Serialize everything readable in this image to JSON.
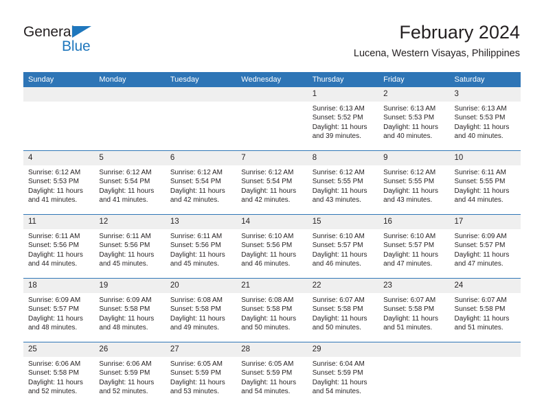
{
  "brand": {
    "name_top": "General",
    "name_bottom": "Blue",
    "accent_color": "#1f77bd"
  },
  "header": {
    "title": "February 2024",
    "subtitle": "Lucena, Western Visayas, Philippines"
  },
  "theme": {
    "header_blue": "#2e75b6",
    "daynum_gray": "#efefef",
    "text": "#231f20"
  },
  "weekday_headers": [
    "Sunday",
    "Monday",
    "Tuesday",
    "Wednesday",
    "Thursday",
    "Friday",
    "Saturday"
  ],
  "weeks": [
    [
      {
        "day": "",
        "sunrise": "",
        "sunset": "",
        "daylight_line1": "",
        "daylight_line2": ""
      },
      {
        "day": "",
        "sunrise": "",
        "sunset": "",
        "daylight_line1": "",
        "daylight_line2": ""
      },
      {
        "day": "",
        "sunrise": "",
        "sunset": "",
        "daylight_line1": "",
        "daylight_line2": ""
      },
      {
        "day": "",
        "sunrise": "",
        "sunset": "",
        "daylight_line1": "",
        "daylight_line2": ""
      },
      {
        "day": "1",
        "sunrise": "Sunrise: 6:13 AM",
        "sunset": "Sunset: 5:52 PM",
        "daylight_line1": "Daylight: 11 hours",
        "daylight_line2": "and 39 minutes."
      },
      {
        "day": "2",
        "sunrise": "Sunrise: 6:13 AM",
        "sunset": "Sunset: 5:53 PM",
        "daylight_line1": "Daylight: 11 hours",
        "daylight_line2": "and 40 minutes."
      },
      {
        "day": "3",
        "sunrise": "Sunrise: 6:13 AM",
        "sunset": "Sunset: 5:53 PM",
        "daylight_line1": "Daylight: 11 hours",
        "daylight_line2": "and 40 minutes."
      }
    ],
    [
      {
        "day": "4",
        "sunrise": "Sunrise: 6:12 AM",
        "sunset": "Sunset: 5:53 PM",
        "daylight_line1": "Daylight: 11 hours",
        "daylight_line2": "and 41 minutes."
      },
      {
        "day": "5",
        "sunrise": "Sunrise: 6:12 AM",
        "sunset": "Sunset: 5:54 PM",
        "daylight_line1": "Daylight: 11 hours",
        "daylight_line2": "and 41 minutes."
      },
      {
        "day": "6",
        "sunrise": "Sunrise: 6:12 AM",
        "sunset": "Sunset: 5:54 PM",
        "daylight_line1": "Daylight: 11 hours",
        "daylight_line2": "and 42 minutes."
      },
      {
        "day": "7",
        "sunrise": "Sunrise: 6:12 AM",
        "sunset": "Sunset: 5:54 PM",
        "daylight_line1": "Daylight: 11 hours",
        "daylight_line2": "and 42 minutes."
      },
      {
        "day": "8",
        "sunrise": "Sunrise: 6:12 AM",
        "sunset": "Sunset: 5:55 PM",
        "daylight_line1": "Daylight: 11 hours",
        "daylight_line2": "and 43 minutes."
      },
      {
        "day": "9",
        "sunrise": "Sunrise: 6:12 AM",
        "sunset": "Sunset: 5:55 PM",
        "daylight_line1": "Daylight: 11 hours",
        "daylight_line2": "and 43 minutes."
      },
      {
        "day": "10",
        "sunrise": "Sunrise: 6:11 AM",
        "sunset": "Sunset: 5:55 PM",
        "daylight_line1": "Daylight: 11 hours",
        "daylight_line2": "and 44 minutes."
      }
    ],
    [
      {
        "day": "11",
        "sunrise": "Sunrise: 6:11 AM",
        "sunset": "Sunset: 5:56 PM",
        "daylight_line1": "Daylight: 11 hours",
        "daylight_line2": "and 44 minutes."
      },
      {
        "day": "12",
        "sunrise": "Sunrise: 6:11 AM",
        "sunset": "Sunset: 5:56 PM",
        "daylight_line1": "Daylight: 11 hours",
        "daylight_line2": "and 45 minutes."
      },
      {
        "day": "13",
        "sunrise": "Sunrise: 6:11 AM",
        "sunset": "Sunset: 5:56 PM",
        "daylight_line1": "Daylight: 11 hours",
        "daylight_line2": "and 45 minutes."
      },
      {
        "day": "14",
        "sunrise": "Sunrise: 6:10 AM",
        "sunset": "Sunset: 5:56 PM",
        "daylight_line1": "Daylight: 11 hours",
        "daylight_line2": "and 46 minutes."
      },
      {
        "day": "15",
        "sunrise": "Sunrise: 6:10 AM",
        "sunset": "Sunset: 5:57 PM",
        "daylight_line1": "Daylight: 11 hours",
        "daylight_line2": "and 46 minutes."
      },
      {
        "day": "16",
        "sunrise": "Sunrise: 6:10 AM",
        "sunset": "Sunset: 5:57 PM",
        "daylight_line1": "Daylight: 11 hours",
        "daylight_line2": "and 47 minutes."
      },
      {
        "day": "17",
        "sunrise": "Sunrise: 6:09 AM",
        "sunset": "Sunset: 5:57 PM",
        "daylight_line1": "Daylight: 11 hours",
        "daylight_line2": "and 47 minutes."
      }
    ],
    [
      {
        "day": "18",
        "sunrise": "Sunrise: 6:09 AM",
        "sunset": "Sunset: 5:57 PM",
        "daylight_line1": "Daylight: 11 hours",
        "daylight_line2": "and 48 minutes."
      },
      {
        "day": "19",
        "sunrise": "Sunrise: 6:09 AM",
        "sunset": "Sunset: 5:58 PM",
        "daylight_line1": "Daylight: 11 hours",
        "daylight_line2": "and 48 minutes."
      },
      {
        "day": "20",
        "sunrise": "Sunrise: 6:08 AM",
        "sunset": "Sunset: 5:58 PM",
        "daylight_line1": "Daylight: 11 hours",
        "daylight_line2": "and 49 minutes."
      },
      {
        "day": "21",
        "sunrise": "Sunrise: 6:08 AM",
        "sunset": "Sunset: 5:58 PM",
        "daylight_line1": "Daylight: 11 hours",
        "daylight_line2": "and 50 minutes."
      },
      {
        "day": "22",
        "sunrise": "Sunrise: 6:07 AM",
        "sunset": "Sunset: 5:58 PM",
        "daylight_line1": "Daylight: 11 hours",
        "daylight_line2": "and 50 minutes."
      },
      {
        "day": "23",
        "sunrise": "Sunrise: 6:07 AM",
        "sunset": "Sunset: 5:58 PM",
        "daylight_line1": "Daylight: 11 hours",
        "daylight_line2": "and 51 minutes."
      },
      {
        "day": "24",
        "sunrise": "Sunrise: 6:07 AM",
        "sunset": "Sunset: 5:58 PM",
        "daylight_line1": "Daylight: 11 hours",
        "daylight_line2": "and 51 minutes."
      }
    ],
    [
      {
        "day": "25",
        "sunrise": "Sunrise: 6:06 AM",
        "sunset": "Sunset: 5:58 PM",
        "daylight_line1": "Daylight: 11 hours",
        "daylight_line2": "and 52 minutes."
      },
      {
        "day": "26",
        "sunrise": "Sunrise: 6:06 AM",
        "sunset": "Sunset: 5:59 PM",
        "daylight_line1": "Daylight: 11 hours",
        "daylight_line2": "and 52 minutes."
      },
      {
        "day": "27",
        "sunrise": "Sunrise: 6:05 AM",
        "sunset": "Sunset: 5:59 PM",
        "daylight_line1": "Daylight: 11 hours",
        "daylight_line2": "and 53 minutes."
      },
      {
        "day": "28",
        "sunrise": "Sunrise: 6:05 AM",
        "sunset": "Sunset: 5:59 PM",
        "daylight_line1": "Daylight: 11 hours",
        "daylight_line2": "and 54 minutes."
      },
      {
        "day": "29",
        "sunrise": "Sunrise: 6:04 AM",
        "sunset": "Sunset: 5:59 PM",
        "daylight_line1": "Daylight: 11 hours",
        "daylight_line2": "and 54 minutes."
      },
      {
        "day": "",
        "sunrise": "",
        "sunset": "",
        "daylight_line1": "",
        "daylight_line2": ""
      },
      {
        "day": "",
        "sunrise": "",
        "sunset": "",
        "daylight_line1": "",
        "daylight_line2": ""
      }
    ]
  ]
}
